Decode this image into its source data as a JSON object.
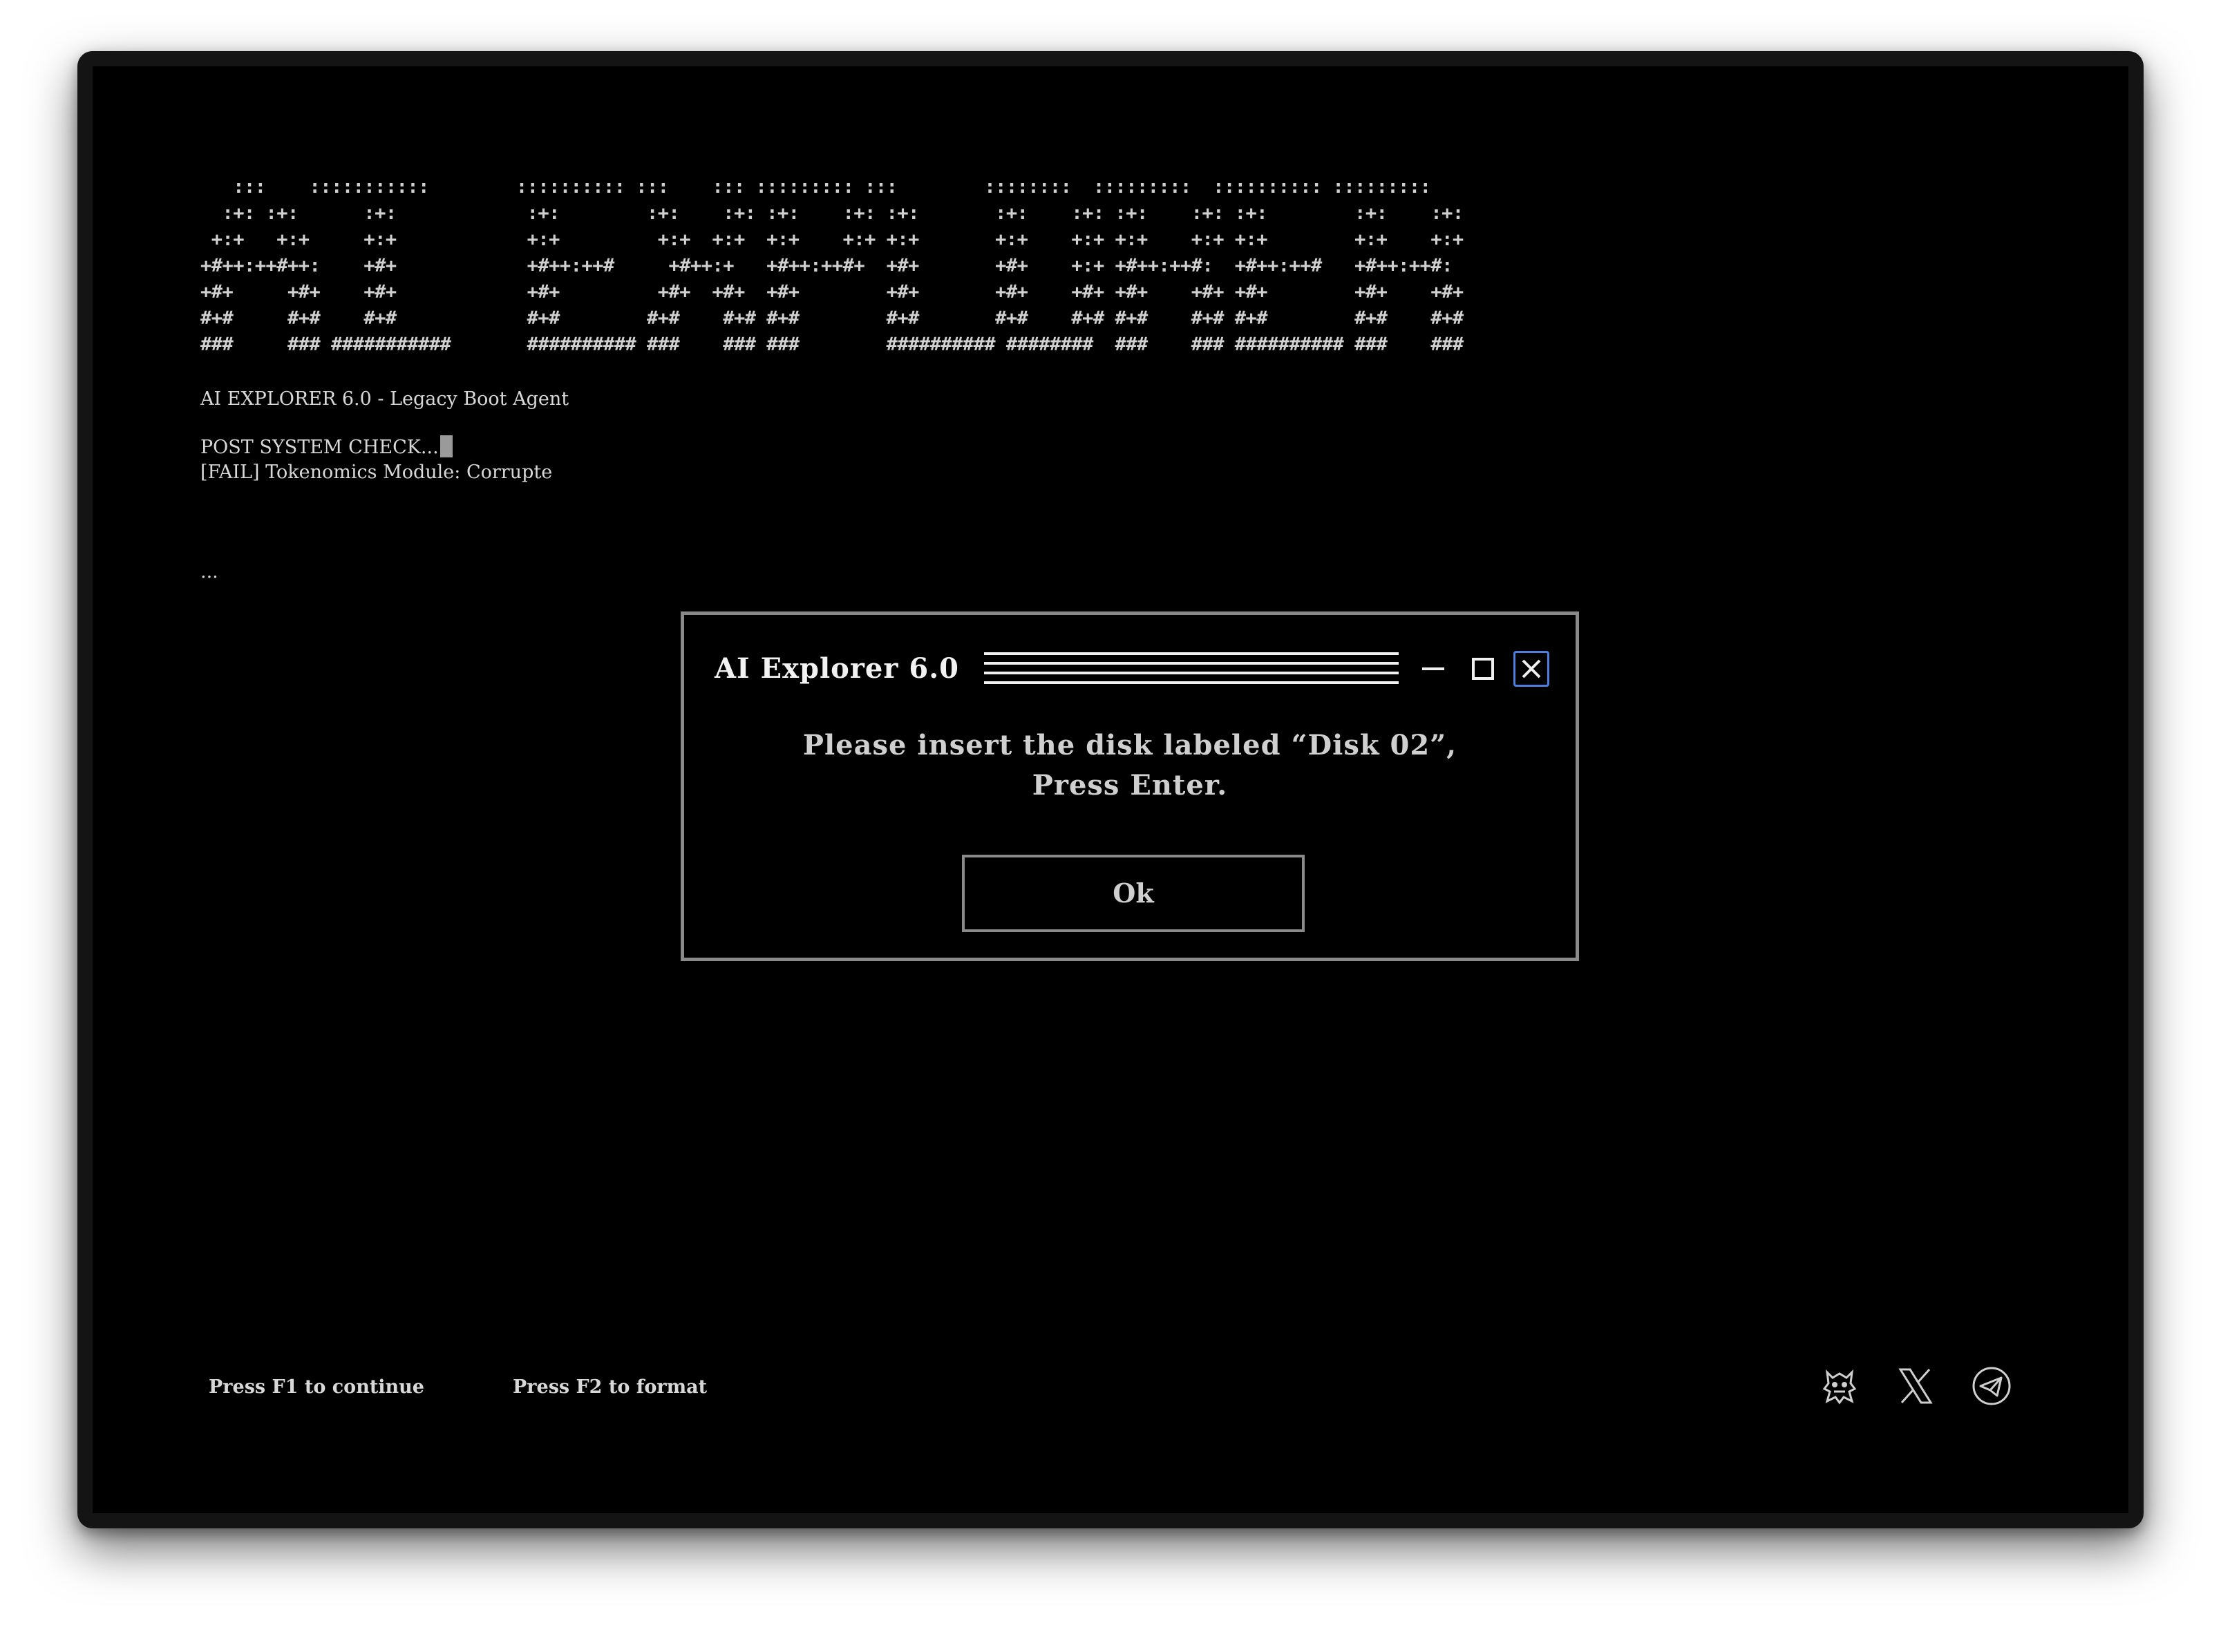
{
  "ascii_logo": [
    "   :::    :::::::::::        :::::::::: :::    ::: ::::::::: :::        ::::::::  :::::::::  :::::::::: :::::::::",
    "  :+: :+:      :+:            :+:        :+:    :+: :+:    :+: :+:       :+:    :+: :+:    :+: :+:        :+:    :+:",
    " +:+   +:+     +:+            +:+         +:+  +:+  +:+    +:+ +:+       +:+    +:+ +:+    +:+ +:+        +:+    +:+",
    "+#++:++#++:    +#+            +#++:++#     +#++:+   +#++:++#+  +#+       +#+    +:+ +#++:++#:  +#++:++#   +#++:++#:",
    "+#+     +#+    +#+            +#+         +#+  +#+  +#+        +#+       +#+    +#+ +#+    +#+ +#+        +#+    +#+",
    "#+#     #+#    #+#            #+#        #+#    #+# #+#        #+#       #+#    #+# #+#    #+# #+#        #+#    #+#",
    "###     ### ###########       ########## ###    ### ###        ########## ########  ###    ### ########## ###    ###"
  ],
  "terminal": {
    "header": "AI EXPLORER 6.0 - Legacy Boot Agent",
    "post_check": "POST SYSTEM CHECK...",
    "fail_line": "[FAIL] Tokenomics Module: Corrupte",
    "ellipsis": "..."
  },
  "dialog": {
    "title": "AI Explorer 6.0",
    "message_line1": "Please insert the disk labeled “Disk 02”,",
    "message_line2": "Press Enter.",
    "ok_label": "Ok"
  },
  "footer": {
    "hint_f1": "Press F1 to continue",
    "hint_f2": "Press F2 to format"
  },
  "social_icons": [
    "mascot-icon",
    "x-twitter-icon",
    "telegram-icon"
  ],
  "colors": {
    "screen_bg": "#000000",
    "text": "#d8d8d8",
    "dialog_border": "#8a8a8a",
    "close_focus": "#4a7fe0"
  }
}
